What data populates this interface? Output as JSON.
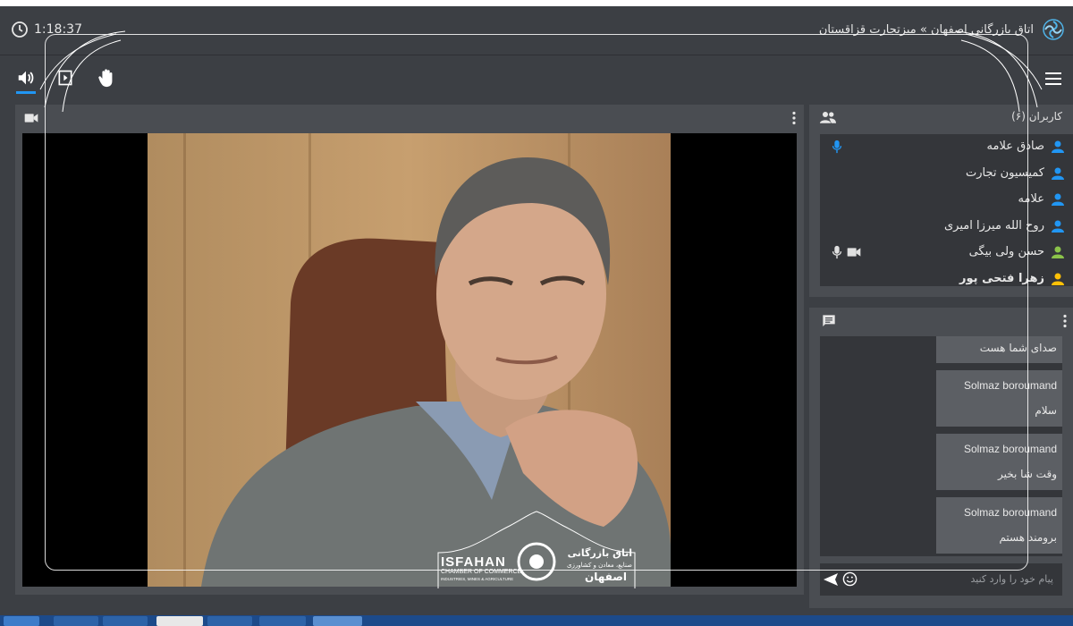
{
  "header": {
    "timer": "1:18:37",
    "room_title": "اتاق بازرگانی اصفهان » میزتجارت قزاقستان"
  },
  "toolbar": {
    "items": [
      {
        "icon": "speaker-icon",
        "active": true
      },
      {
        "icon": "screen-share-icon",
        "active": false
      },
      {
        "icon": "raise-hand-icon",
        "active": false
      }
    ]
  },
  "users": {
    "title": "کاربران (۶)",
    "list": [
      {
        "name": "صادق علامه",
        "icon_color": "#2196f3",
        "mic": true,
        "mic_color": "#2196f3",
        "cam": false
      },
      {
        "name": "کمیسیون تجارت",
        "icon_color": "#2196f3",
        "mic": false,
        "cam": false
      },
      {
        "name": "علامه",
        "icon_color": "#2196f3",
        "mic": false,
        "cam": false
      },
      {
        "name": "روح الله میرزا امیری",
        "icon_color": "#2196f3",
        "mic": false,
        "cam": false
      },
      {
        "name": "حسن ولی بیگی",
        "icon_color": "#8bc34a",
        "mic": true,
        "mic_color": "#e0e0e0",
        "cam": true
      },
      {
        "name": "زهرا فتحی پور",
        "icon_color": "#ffc107",
        "mic": false,
        "cam": false
      }
    ]
  },
  "chat": {
    "messages": [
      {
        "sender": "",
        "text": "صدای شما هست"
      },
      {
        "sender": "Solmaz boroumand",
        "text": "سلام"
      },
      {
        "sender": "Solmaz boroumand",
        "text": "وقت شا بخیر"
      },
      {
        "sender": "Solmaz boroumand",
        "text": "برومند هستم"
      }
    ],
    "input_placeholder": "پیام خود را وارد کنید"
  },
  "branding": {
    "en_name": "ISFAHAN",
    "en_sub": "CHAMBER OF COMMERCE",
    "en_sub2": "INDUSTRIES, MINES & AGRICULTURE",
    "fa_name": "اتاق بازرگانی",
    "fa_sub": "صنایع، معادن و کشاورزی",
    "fa_city": "اصفهان"
  },
  "colors": {
    "accent": "#2196f3",
    "panel": "#4a4d52",
    "background": "#3c3f44"
  }
}
